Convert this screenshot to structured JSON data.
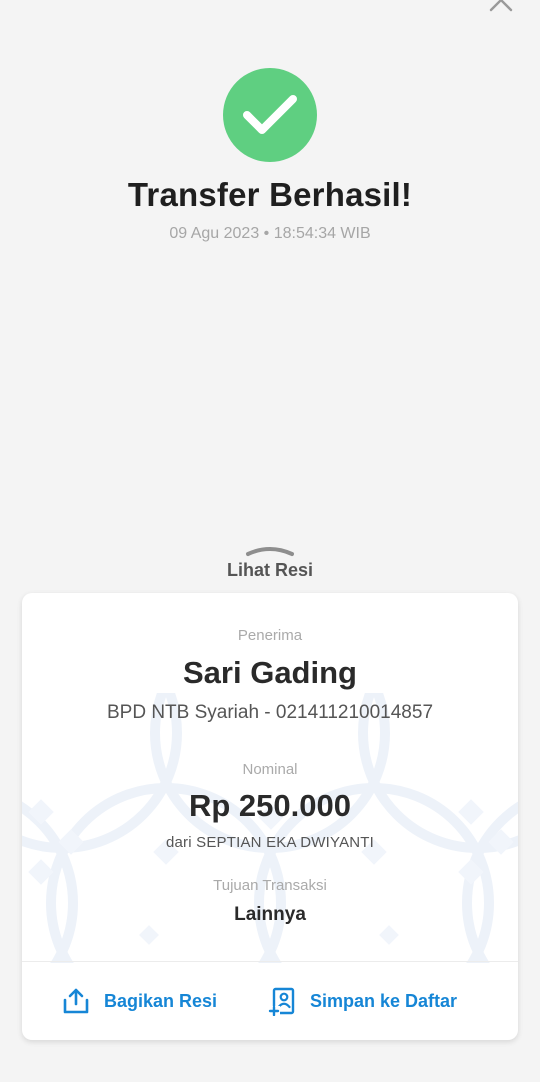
{
  "header": {
    "title": "Transfer Berhasil!",
    "datetime": "09 Agu 2023 • 18:54:34 WIB",
    "close_icon": "close-icon",
    "status_icon": "checkmark-icon",
    "status_color": "#5fcf81"
  },
  "sheet": {
    "toggle_label": "Lihat Resi"
  },
  "receipt": {
    "recipient_label": "Penerima",
    "recipient_name": "Sari Gading",
    "recipient_bank_account": "BPD NTB Syariah - 021411210014857",
    "amount_label": "Nominal",
    "amount": "Rp 250.000",
    "sender": "dari SEPTIAN EKA DWIYANTI",
    "purpose_label": "Tujuan Transaksi",
    "purpose": "Lainnya"
  },
  "actions": {
    "share_label": "Bagikan Resi",
    "share_icon": "share-icon",
    "save_label": "Simpan ke Daftar",
    "save_icon": "add-contact-icon",
    "accent_color": "#1686d6"
  }
}
